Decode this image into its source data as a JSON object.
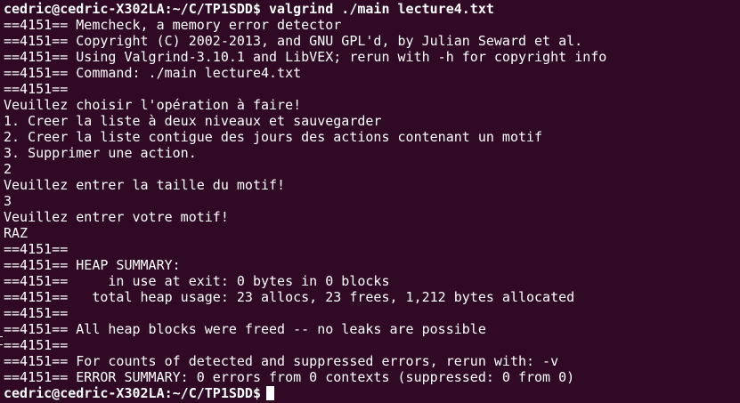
{
  "terminal": {
    "lines": [
      "cedric@cedric-X302LA:~/C/TP1SDD$ valgrind ./main lecture4.txt",
      "==4151== Memcheck, a memory error detector",
      "==4151== Copyright (C) 2002-2013, and GNU GPL'd, by Julian Seward et al.",
      "==4151== Using Valgrind-3.10.1 and LibVEX; rerun with -h for copyright info",
      "==4151== Command: ./main lecture4.txt",
      "==4151==",
      "Veuillez choisir l'opération à faire!",
      "1. Creer la liste à deux niveaux et sauvegarder",
      "2. Creer la liste contigue des jours des actions contenant un motif",
      "3. Supprimer une action.",
      "2",
      "Veuillez entrer la taille du motif!",
      "3",
      "Veuillez entrer votre motif!",
      "RAZ",
      "==4151==",
      "==4151== HEAP SUMMARY:",
      "==4151==     in use at exit: 0 bytes in 0 blocks",
      "==4151==   total heap usage: 23 allocs, 23 frees, 1,212 bytes allocated",
      "==4151==",
      "==4151== All heap blocks were freed -- no leaks are possible",
      "==4151==",
      "==4151== For counts of detected and suppressed errors, rerun with: -v",
      "==4151== ERROR SUMMARY: 0 errors from 0 contexts (suppressed: 0 from 0)"
    ],
    "prompt": "cedric@cedric-X302LA:~/C/TP1SDD$",
    "colors": {
      "background": "#300a24",
      "foreground": "#ffffff"
    }
  }
}
